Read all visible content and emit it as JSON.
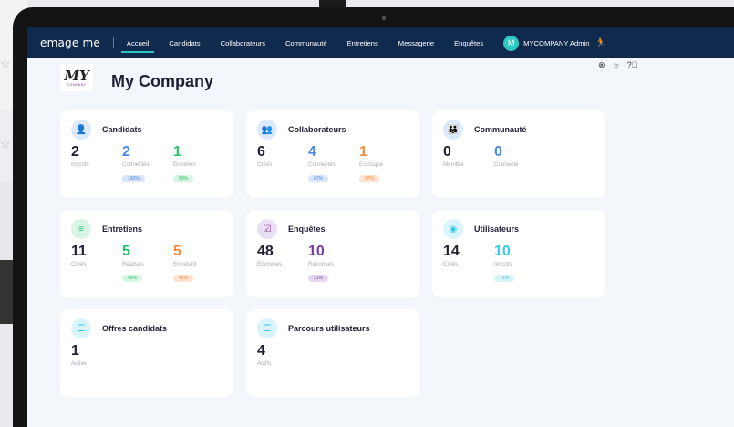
{
  "navbar": {
    "logo": "emage me",
    "items": [
      "Accueil",
      "Candidats",
      "Collaborateurs",
      "Communauté",
      "Entretiens",
      "Messagerie",
      "Enquêtes"
    ],
    "active": "Accueil",
    "user_initial": "M",
    "user_name": "MYCOMPANY Admin"
  },
  "header": {
    "logo_text": "MY",
    "logo_sub": "COMPANY",
    "title": "My Company"
  },
  "cards": {
    "candidats": {
      "title": "Candidats",
      "stats": [
        {
          "value": "2",
          "label": "Inscrits"
        },
        {
          "value": "2",
          "label": "Connectés",
          "badge": "100%"
        },
        {
          "value": "1",
          "label": "Entretien",
          "badge": "50%"
        }
      ]
    },
    "collaborateurs": {
      "title": "Collaborateurs",
      "stats": [
        {
          "value": "6",
          "label": "Créés"
        },
        {
          "value": "4",
          "label": "Connectés",
          "badge": "67%"
        },
        {
          "value": "1",
          "label": "En risque",
          "badge": "17%"
        }
      ]
    },
    "communaute": {
      "title": "Communauté",
      "stats": [
        {
          "value": "0",
          "label": "Membre"
        },
        {
          "value": "0",
          "label": "Connecté"
        }
      ]
    },
    "entretiens": {
      "title": "Entretiens",
      "stats": [
        {
          "value": "11",
          "label": "Créés"
        },
        {
          "value": "5",
          "label": "Réalisés",
          "badge": "45%"
        },
        {
          "value": "5",
          "label": "En retard",
          "badge": "45%"
        }
      ]
    },
    "enquetes": {
      "title": "Enquêtes",
      "stats": [
        {
          "value": "48",
          "label": "Envoyées"
        },
        {
          "value": "10",
          "label": "Réponses",
          "badge": "21%"
        }
      ]
    },
    "utilisateurs": {
      "title": "Utilisateurs",
      "stats": [
        {
          "value": "14",
          "label": "Créés"
        },
        {
          "value": "10",
          "label": "Inscrits",
          "badge": "71%"
        }
      ]
    },
    "offres": {
      "title": "Offres candidats",
      "stats": [
        {
          "value": "1",
          "label": "Active"
        }
      ]
    },
    "parcours": {
      "title": "Parcours utilisateurs",
      "stats": [
        {
          "value": "4",
          "label": "Actifs"
        }
      ]
    }
  },
  "colors": {
    "navbar": "#0f2a4d",
    "accent": "#2ec7c0",
    "blue": "#4a86e8",
    "green": "#2cc06d",
    "orange": "#f28b46",
    "purple": "#7a3aa6",
    "cyan": "#37c8e8"
  }
}
